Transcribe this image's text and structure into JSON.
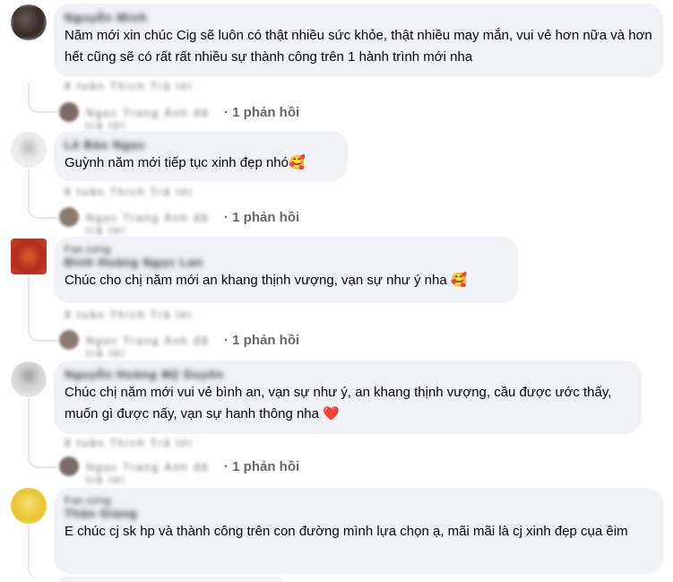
{
  "comments": [
    {
      "author": "Nguyễn Minh",
      "text": "Năm mới xin chúc Cig sẽ luôn có thật nhiều sức khỏe, thật nhiều may mắn, vui vẻ hơn nữa và hơn hết cũng sẽ có rất rất nhiều sự thành công trên 1 hành trình mới nha",
      "meta": "8 tuần  Thích  Trả lời",
      "reply_names": "Ngọc Trang Ánh đã trả lời",
      "reply_count": "· 1 phản hồi"
    },
    {
      "author": "Lê Bảo Ngọc",
      "text": "Guỳnh năm mới tiếp tục xinh đẹp nhó",
      "emoji": "🥰",
      "meta": "8 tuần  Thích  Trả lời",
      "reply_names": "Ngọc Trang Ánh đã trả lời",
      "reply_count": "· 1 phản hồi"
    },
    {
      "author_top": "Fan cứng",
      "author": "Đinh Hoàng Ngọc Lan",
      "text": "Chúc cho chị năm mới an khang thịnh vượng, vạn sự như ý nha",
      "emoji": "🥰",
      "meta": "8 tuần  Thích  Trả lời",
      "reply_names": "Ngọc Trang Ánh đã trả lời",
      "reply_count": "· 1 phản hồi"
    },
    {
      "author": "Nguyễn Hoàng Mỹ Duyên",
      "text": "Chúc chị năm mới vui vẻ bình an, vạn sự như ý, an khang thịnh vượng, cầu được ước thấy, muốn gì được nấy, vạn sự hanh thông nha",
      "emoji": "❤️",
      "meta": "8 tuần  Thích  Trả lời",
      "reply_names": "Ngọc Trang Ánh đã trả lời",
      "reply_count": "· 1 phản hồi"
    },
    {
      "author_top": "Fan cứng",
      "author": "Thảo Giang",
      "text": "E chúc cj sk hp và thành công trên con đường mình lựa chọn ạ, mãi mãi là cj xinh đẹp cụa êim"
    }
  ],
  "colors": {
    "bubble": "#f0f2f5",
    "secondary_text": "#65676b",
    "thread_line": "#e4e6eb"
  }
}
